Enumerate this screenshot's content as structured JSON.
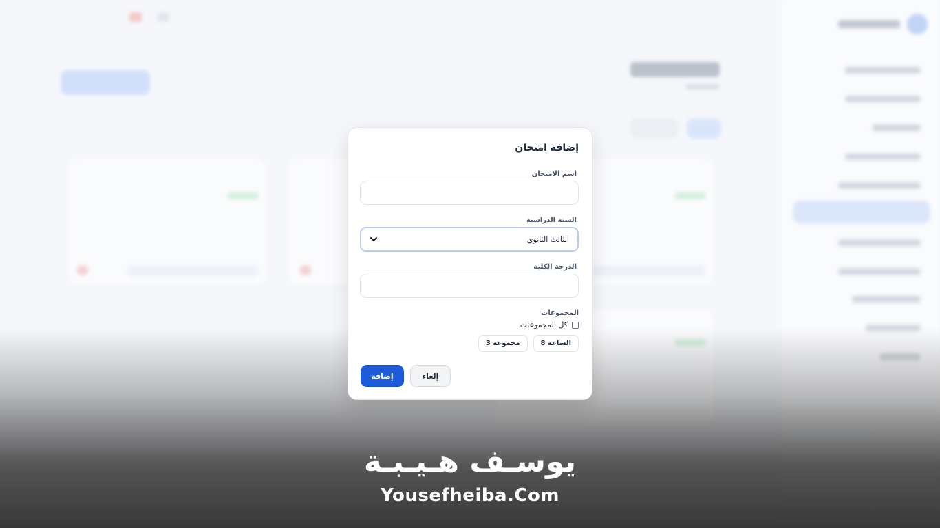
{
  "modal": {
    "title": "إضافة امتحان",
    "exam_name_label": "اسم الامتحان",
    "exam_name_value": "",
    "year_label": "السنة الدراسية",
    "year_value": "الثالث الثانوي",
    "total_grade_label": "الدرجة الكلية",
    "total_grade_value": "",
    "groups_label": "المجموعات",
    "all_groups_label": "كل المجموعات",
    "all_groups_checked": false,
    "group_chips": [
      "الساعه 8",
      "مجموعة 3"
    ],
    "cancel_label": "إلغاء",
    "add_label": "إضافة"
  },
  "watermark": {
    "name": "يوسـف هـيـبـة",
    "site": "Yousefheiba.Com"
  },
  "colors": {
    "primary": "#1e5bd8",
    "focus_border": "#b9ccf3"
  },
  "icons": {
    "select_arrow": "chevron-down-icon"
  }
}
